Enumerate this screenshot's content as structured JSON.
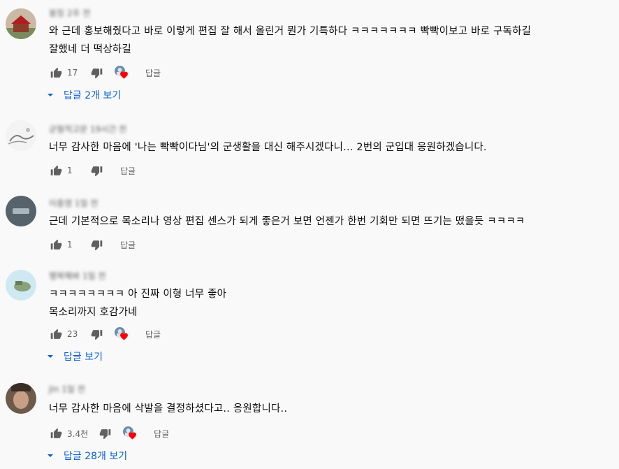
{
  "comments": [
    {
      "author": "봉칭 2주 전",
      "text_lines": [
        "와 근데 홍보해줬다고 바로 이렇게 편집 잘 해서 올린거 뭔가 기특하다 ㅋㅋㅋㅋㅋㅋㅋ 빡빡이보고 바로 구독하길",
        "잘했네 더 떡상하길"
      ],
      "likes": "17",
      "reply_label": "답글",
      "view_replies": "답글 2개 보기",
      "creator_heart": true
    },
    {
      "author": "균형적고문 19시간 전",
      "text_lines": [
        "너무 감사한 마음에 '나는 빡빡이다님'의 군생활을 대신 해주시겠다니... 2번의 군입대 응원하겠습니다."
      ],
      "likes": "1",
      "reply_label": "답글",
      "creator_heart": false
    },
    {
      "author": "이충영 1일 전",
      "text_lines": [
        "근데 기본적으로 목소리나 영상 편집 센스가 되게 좋은거 보면 언젠가 한번 기회만 되면 뜨기는 떴을듯 ㅋㅋㅋㅋ"
      ],
      "likes": "1",
      "reply_label": "답글",
      "creator_heart": false
    },
    {
      "author": "행복해봐 1일 전",
      "text_lines": [
        "ㅋㅋㅋㅋㅋㅋㅋㅋ 아 진짜 이형 너무 좋아",
        "목소리까지 호감가네"
      ],
      "likes": "23",
      "reply_label": "답글",
      "view_replies": "답글 보기",
      "creator_heart": true
    },
    {
      "author": "Jin 1일 전",
      "text_lines": [
        "너무 감사한 마음에 삭발을 결정하셨다고.. 응원합니다.."
      ],
      "likes": "3.4천",
      "reply_label": "답글",
      "view_replies": "답글 28개 보기",
      "creator_heart": true
    }
  ],
  "icons": {
    "like": "thumb-up-icon",
    "dislike": "thumb-down-icon",
    "heart": "creator-heart-icon",
    "caret": "caret-down-icon"
  },
  "colors": {
    "link_blue": "#065fd4",
    "heart_red": "#ff0000",
    "meta_gray": "#606060"
  }
}
